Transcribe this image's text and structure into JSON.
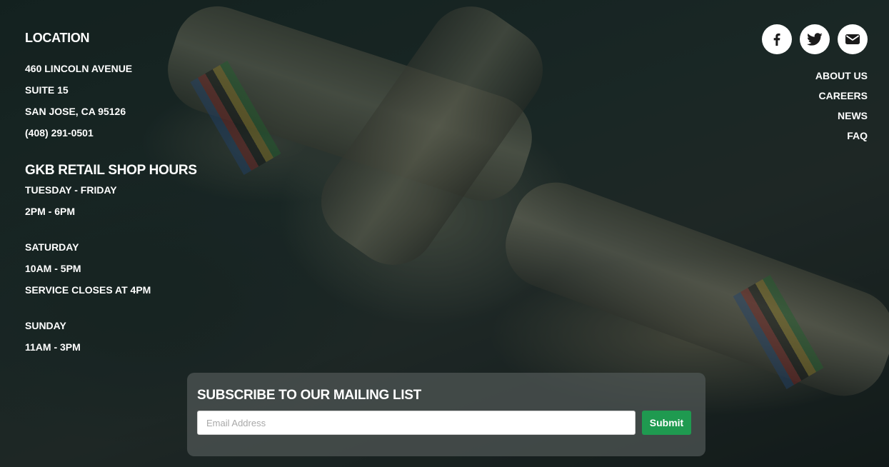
{
  "location": {
    "heading": "LOCATION",
    "address_line1": "460 LINCOLN AVENUE",
    "address_line2": "SUITE 15",
    "city_state_zip": "SAN JOSE, CA 95126",
    "phone": "(408) 291-0501"
  },
  "hours": {
    "heading": "GKB RETAIL SHOP HOURS",
    "weekday_label": "TUESDAY - FRIDAY",
    "weekday_time": "2PM - 6PM",
    "saturday_label": "SATURDAY",
    "saturday_time": "10AM - 5PM",
    "saturday_note": "SERVICE CLOSES AT 4PM",
    "sunday_label": "SUNDAY",
    "sunday_time": "11AM - 3PM"
  },
  "social": [
    {
      "icon": "facebook-icon"
    },
    {
      "icon": "twitter-icon"
    },
    {
      "icon": "mail-icon"
    }
  ],
  "nav": {
    "about": "ABOUT US",
    "careers": "CAREERS",
    "news": "NEWS",
    "faq": "FAQ"
  },
  "subscribe": {
    "title": "SUBSCRIBE TO OUR MAILING LIST",
    "email_placeholder": "Email Address",
    "email_value": "",
    "submit_label": "Submit"
  },
  "colors": {
    "accent_green": "#1f9a50",
    "text": "#ffffff",
    "panel": "#505856"
  }
}
